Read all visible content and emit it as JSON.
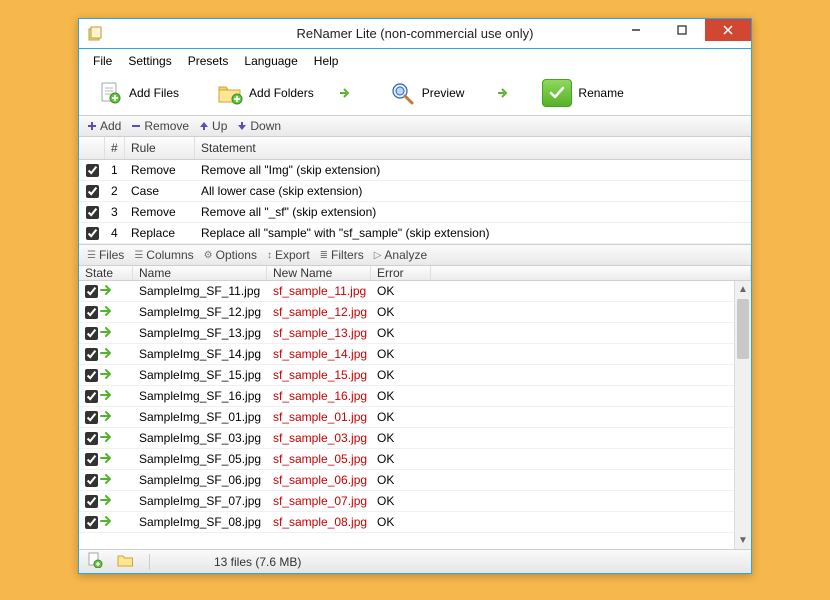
{
  "window": {
    "title": "ReNamer Lite (non-commercial use only)"
  },
  "menu": {
    "file": "File",
    "settings": "Settings",
    "presets": "Presets",
    "language": "Language",
    "help": "Help"
  },
  "toolbar": {
    "add_files": "Add Files",
    "add_folders": "Add Folders",
    "preview": "Preview",
    "rename": "Rename"
  },
  "rule_toolbar": {
    "add": "Add",
    "remove": "Remove",
    "up": "Up",
    "down": "Down"
  },
  "rules_header": {
    "num": "#",
    "rule": "Rule",
    "statement": "Statement"
  },
  "rules": [
    {
      "checked": true,
      "num": "1",
      "rule": "Remove",
      "statement": "Remove all \"Img\" (skip extension)"
    },
    {
      "checked": true,
      "num": "2",
      "rule": "Case",
      "statement": "All lower case (skip extension)"
    },
    {
      "checked": true,
      "num": "3",
      "rule": "Remove",
      "statement": "Remove all \"_sf\" (skip extension)"
    },
    {
      "checked": true,
      "num": "4",
      "rule": "Replace",
      "statement": "Replace all \"sample\" with \"sf_sample\" (skip extension)"
    }
  ],
  "file_toolbar": {
    "files": "Files",
    "columns": "Columns",
    "options": "Options",
    "export": "Export",
    "filters": "Filters",
    "analyze": "Analyze"
  },
  "files_header": {
    "state": "State",
    "name": "Name",
    "new_name": "New Name",
    "error": "Error"
  },
  "files": [
    {
      "name": "SampleImg_SF_11.jpg",
      "new_name": "sf_sample_11.jpg",
      "error": "OK"
    },
    {
      "name": "SampleImg_SF_12.jpg",
      "new_name": "sf_sample_12.jpg",
      "error": "OK"
    },
    {
      "name": "SampleImg_SF_13.jpg",
      "new_name": "sf_sample_13.jpg",
      "error": "OK"
    },
    {
      "name": "SampleImg_SF_14.jpg",
      "new_name": "sf_sample_14.jpg",
      "error": "OK"
    },
    {
      "name": "SampleImg_SF_15.jpg",
      "new_name": "sf_sample_15.jpg",
      "error": "OK"
    },
    {
      "name": "SampleImg_SF_16.jpg",
      "new_name": "sf_sample_16.jpg",
      "error": "OK"
    },
    {
      "name": "SampleImg_SF_01.jpg",
      "new_name": "sf_sample_01.jpg",
      "error": "OK"
    },
    {
      "name": "SampleImg_SF_03.jpg",
      "new_name": "sf_sample_03.jpg",
      "error": "OK"
    },
    {
      "name": "SampleImg_SF_05.jpg",
      "new_name": "sf_sample_05.jpg",
      "error": "OK"
    },
    {
      "name": "SampleImg_SF_06.jpg",
      "new_name": "sf_sample_06.jpg",
      "error": "OK"
    },
    {
      "name": "SampleImg_SF_07.jpg",
      "new_name": "sf_sample_07.jpg",
      "error": "OK"
    },
    {
      "name": "SampleImg_SF_08.jpg",
      "new_name": "sf_sample_08.jpg",
      "error": "OK"
    }
  ],
  "status": {
    "text": "13 files (7.6 MB)"
  }
}
